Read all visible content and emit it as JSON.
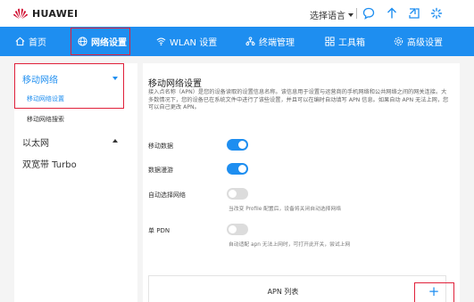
{
  "brand": {
    "name": "HUAWEI",
    "color": "#cf0a2c"
  },
  "topbar": {
    "language_label": "选择语言",
    "icons": [
      "chat-bubble-icon",
      "upload-arrow-icon",
      "logout-icon",
      "loading-spinner-icon"
    ]
  },
  "nav": {
    "items": [
      {
        "label": "首页",
        "icon": "home-icon"
      },
      {
        "label": "网络设置",
        "icon": "globe-icon",
        "active": true
      },
      {
        "label": "WLAN 设置",
        "icon": "wifi-icon"
      },
      {
        "label": "终端管理",
        "icon": "devices-icon"
      },
      {
        "label": "工具箱",
        "icon": "toolbox-icon"
      },
      {
        "label": "高级设置",
        "icon": "gear-icon"
      }
    ],
    "accent": "#1e8ef0"
  },
  "sidebar": {
    "groups": [
      {
        "label": "移动网络",
        "expanded": true,
        "items": [
          {
            "label": "移动网络设置",
            "active": true
          },
          {
            "label": "移动网络搜索"
          }
        ]
      },
      {
        "label": "以太网",
        "expanded": false
      },
      {
        "label": "双宽带 Turbo"
      }
    ]
  },
  "main": {
    "title": "移动网络设置",
    "description": "接入点名称（APN）是您的设备读取的设置信息名称。该信息用于设置与运营商的手机网络和公共网络之间的网关连接。大多数情况下，您的设备已在系统文件中进行了该些设置，并且可以在编时自动填写 APN 信息。如果自动 APN 无法上网，您可以自己更改 APN。",
    "rows": [
      {
        "label": "移动数据",
        "on": true,
        "hint": ""
      },
      {
        "label": "数据漫游",
        "on": true,
        "hint": ""
      },
      {
        "label": "自动选择网络",
        "on": false,
        "hint": "当改变 Profile 配置后，设备将关闭自动选择网络"
      },
      {
        "label": "单 PDN",
        "on": false,
        "hint": "自动适配 apn 无法上网时，可打开此开关，尝试上网"
      }
    ],
    "apn_list_title": "APN 列表",
    "apn_add_symbol": "+"
  },
  "highlight_color": "#e0203a"
}
